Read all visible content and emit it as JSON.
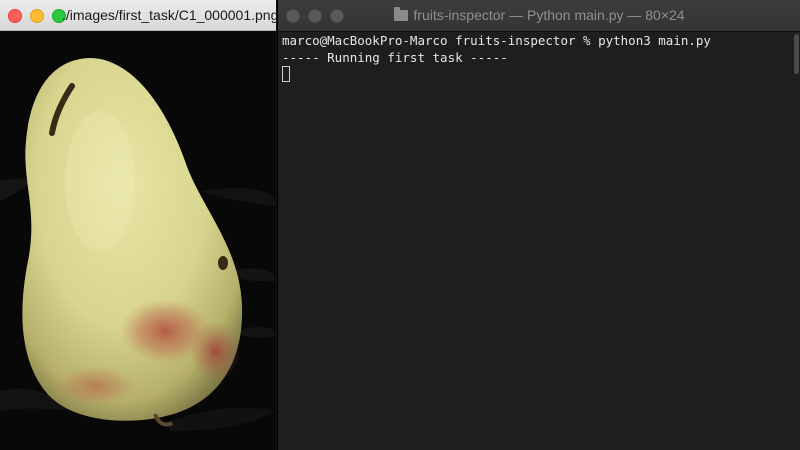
{
  "image_window": {
    "title": "./images/first_task/C1_000001.png",
    "image_subject": "pear-photo"
  },
  "terminal_window": {
    "title": "fruits-inspector — Python main.py — 80×24",
    "lines": {
      "prompt": "marco@MacBookPro-Marco fruits-inspector % python3 main.py",
      "output": "----- Running first task -----"
    }
  },
  "colors": {
    "close": "#fe5f57",
    "minimize": "#febc2e",
    "zoom": "#28c840",
    "terminal_bg": "#1e1e1e",
    "terminal_text": "#e6e6e6"
  }
}
